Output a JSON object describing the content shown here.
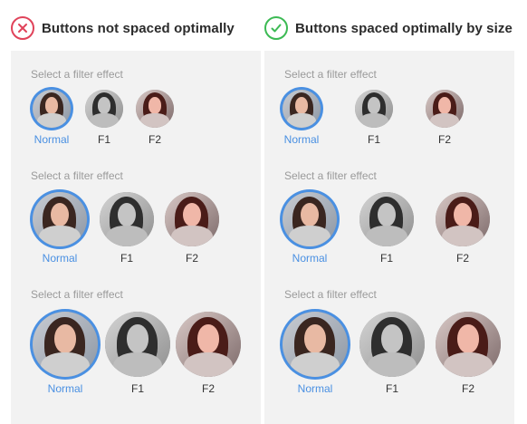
{
  "left_header": {
    "title": "Buttons not spaced optimally",
    "icon": "x-icon",
    "color": "#e0435a"
  },
  "right_header": {
    "title": "Buttons spaced optimally by size",
    "icon": "check-icon",
    "color": "#3cba54"
  },
  "caption": "Select a filter effect",
  "filters": [
    {
      "label": "Normal",
      "variant": "color",
      "selected": true
    },
    {
      "label": "F1",
      "variant": "grayscale",
      "selected": false
    },
    {
      "label": "F2",
      "variant": "warm",
      "selected": false
    }
  ],
  "colors": {
    "accent": "#4a90e2",
    "panel": "#f2f2f2",
    "caption": "#9a9a9a",
    "label": "#333333"
  }
}
